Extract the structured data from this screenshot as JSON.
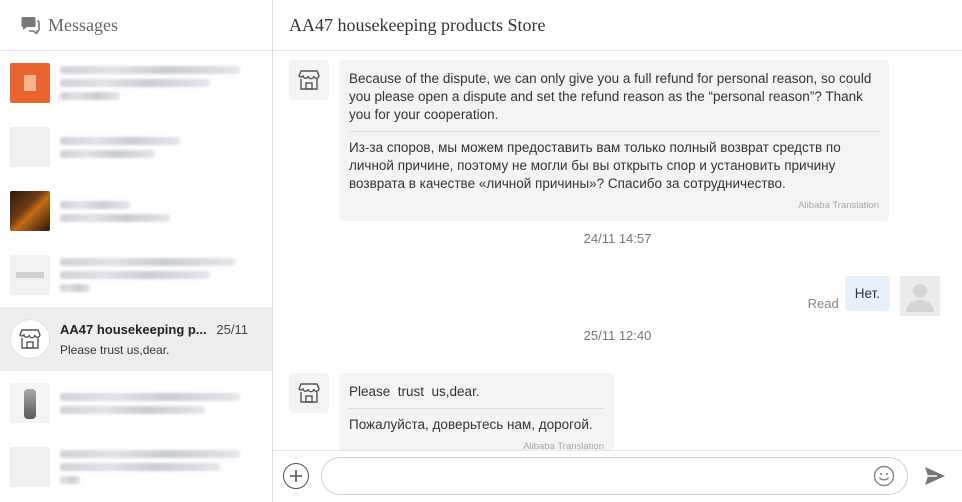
{
  "sidebar": {
    "title": "Messages",
    "conversations": [
      {
        "avatar": "orange-store-avatar",
        "blurred": true
      },
      {
        "avatar": "light-avatar",
        "blurred": true
      },
      {
        "avatar": "dark-photo-avatar",
        "blurred": true
      },
      {
        "avatar": "gray-avatar",
        "blurred": true
      },
      {
        "avatar": "store-icon",
        "name": "AA47 housekeeping p...",
        "date": "25/11",
        "preview": "Please trust us,dear.",
        "active": true
      },
      {
        "avatar": "bottle-avatar",
        "blurred": true
      },
      {
        "avatar": "light-avatar",
        "blurred": true
      }
    ]
  },
  "chat": {
    "title": "AA47 housekeeping products Store",
    "messages": [
      {
        "from": "store",
        "text": "Because of the dispute, we can only give you a full refund for personal reason, so could you please open a dispute and set the refund reason as the “personal reason”? Thank you for your cooperation.",
        "translation": "Из-за споров, мы можем предоставить вам только полный возврат средств по личной причине, поэтому не могли бы вы открыть спор и установить причину возврата в качестве «личной причины»? Спасибо за сотрудничество.",
        "translation_tag": "Alibaba Translation"
      },
      {
        "timestamp": "24/11 14:57"
      },
      {
        "from": "me",
        "text": "Нет.",
        "status": "Read"
      },
      {
        "timestamp": "25/11 12:40"
      },
      {
        "from": "store",
        "text": "Please  trust  us,dear.",
        "translation": "Пожалуйста, доверьтесь нам, дорогой.",
        "translation_tag": "Alibaba Translation"
      }
    ]
  },
  "composer": {
    "placeholder": "",
    "value": ""
  },
  "colors": {
    "accent_bubble": "#e8f1fb",
    "store_bubble": "#f4f4f4",
    "active_row": "#eeeeee"
  }
}
